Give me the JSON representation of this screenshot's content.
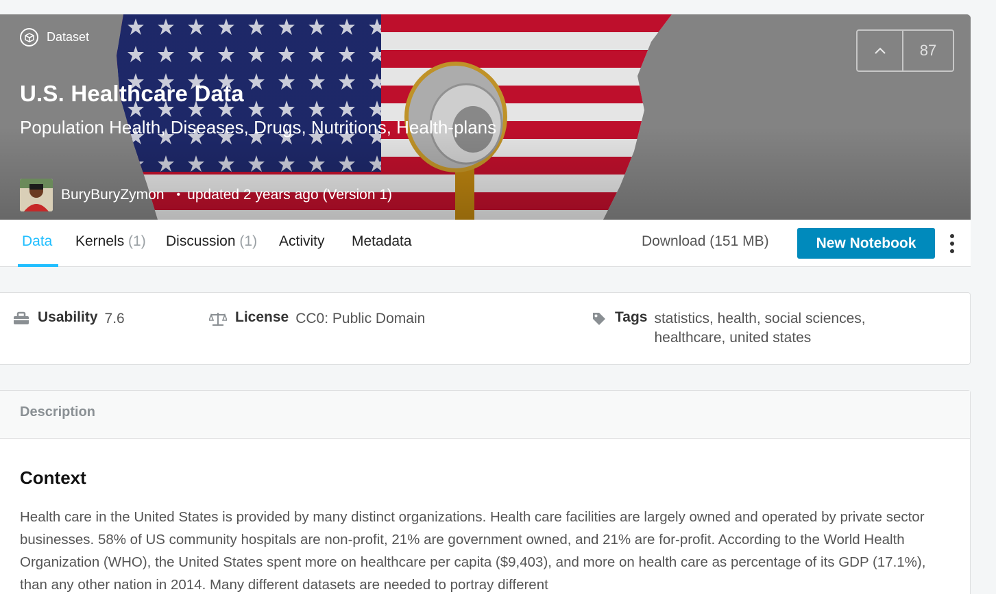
{
  "hero": {
    "badge": "Dataset",
    "title": "U.S. Healthcare Data",
    "subtitle": "Population Health, Diseases, Drugs, Nutritions, Health-plans",
    "author": "BuryBuryZymon",
    "updated": "updated 2 years ago (Version 1)",
    "votes": "87"
  },
  "tabs": [
    {
      "label": "Data",
      "count": ""
    },
    {
      "label": "Kernels",
      "count": "(1)"
    },
    {
      "label": "Discussion",
      "count": "(1)"
    },
    {
      "label": "Activity",
      "count": ""
    },
    {
      "label": "Metadata",
      "count": ""
    }
  ],
  "actions": {
    "download": "Download (151 MB)",
    "new_notebook": "New Notebook"
  },
  "meta": {
    "usability_label": "Usability",
    "usability_value": "7.6",
    "license_label": "License",
    "license_value": "CC0: Public Domain",
    "tags_label": "Tags",
    "tags_line1": "statistics, health, social sciences,",
    "tags_line2": "healthcare, united states"
  },
  "description": {
    "header": "Description",
    "heading": "Context",
    "body": "Health care in the United States is provided by many distinct organizations. Health care facilities are largely owned and operated by private sector businesses. 58% of US community hospitals are non-profit, 21% are government owned, and 21% are for-profit. According to the World Health Organization (WHO), the United States spent more on healthcare per capita ($9,403), and more on health care as percentage of its GDP (17.1%), than any other nation in 2014. Many different datasets are needed to portray different"
  },
  "colors": {
    "accent": "#20beff",
    "button": "#008abc",
    "flag_red": "#c8102e",
    "flag_blue": "#1f2a6e"
  }
}
